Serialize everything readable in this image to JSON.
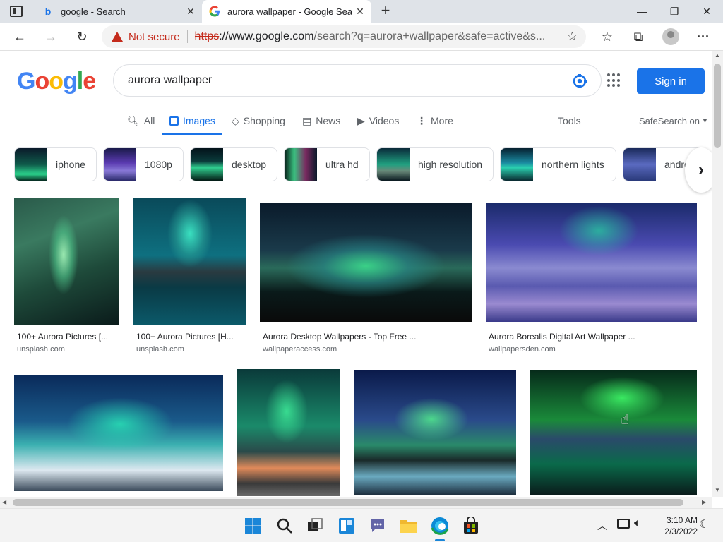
{
  "browser": {
    "tabs": [
      {
        "title": "google - Search",
        "favicon": "bing-icon"
      },
      {
        "title": "aurora wallpaper - Google Search",
        "favicon": "google-icon"
      }
    ],
    "security_label": "Not secure",
    "url_scheme": "https",
    "url_host": "://www.google.com",
    "url_rest": "/search?q=aurora+wallpaper&safe=active&s..."
  },
  "google": {
    "logo": "Google",
    "query": "aurora wallpaper",
    "signin_label": "Sign in",
    "tabs": [
      {
        "label": "All",
        "icon": "search-icon"
      },
      {
        "label": "Images",
        "icon": "image-icon"
      },
      {
        "label": "Shopping",
        "icon": "tag-icon"
      },
      {
        "label": "News",
        "icon": "news-icon"
      },
      {
        "label": "Videos",
        "icon": "play-icon"
      },
      {
        "label": "More",
        "icon": "kebab-icon"
      }
    ],
    "tools_label": "Tools",
    "safesearch_label": "SafeSearch on"
  },
  "chips": [
    {
      "label": "iphone"
    },
    {
      "label": "1080p"
    },
    {
      "label": "desktop"
    },
    {
      "label": "ultra hd"
    },
    {
      "label": "high resolution"
    },
    {
      "label": "northern lights"
    },
    {
      "label": "andro"
    }
  ],
  "results": [
    {
      "caption": "100+ Aurora Pictures [...",
      "source": "unsplash.com"
    },
    {
      "caption": "100+ Aurora Pictures [H...",
      "source": "unsplash.com"
    },
    {
      "caption": "Aurora Desktop Wallpapers - Top Free ...",
      "source": "wallpaperaccess.com"
    },
    {
      "caption": "Aurora Borealis Digital Art Wallpaper ...",
      "source": "wallpapersden.com"
    }
  ],
  "taskbar": {
    "time": "3:10 AM",
    "date": "2/3/2022"
  },
  "colors": {
    "accent": "#1a73e8",
    "warning": "#c42b1c"
  }
}
